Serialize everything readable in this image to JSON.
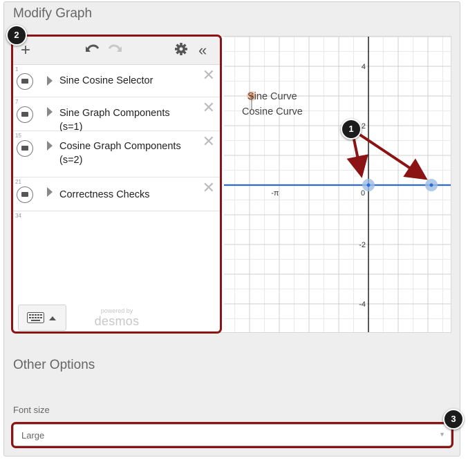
{
  "page": {
    "modify_graph_title": "Modify Graph",
    "other_options_title": "Other Options",
    "font_size_label": "Font size",
    "font_size_value": "Large"
  },
  "desmos": {
    "toolbar": {
      "add_icon": "plus-icon",
      "undo_icon": "undo-icon",
      "redo_icon": "redo-icon",
      "settings_icon": "gear-icon",
      "collapse_icon": "double-chevron-left-icon"
    },
    "expressions": [
      {
        "num": "1",
        "label": "Sine Cosine Selector"
      },
      {
        "num": "7",
        "label": "Sine Graph Components (s=1)"
      },
      {
        "num": "15",
        "label": "Cosine Graph Components (s=2)"
      },
      {
        "num": "21",
        "label": "Correctness Checks"
      }
    ],
    "empty_row_num": "34",
    "powered_by": "powered by",
    "brand": "desmos"
  },
  "graph": {
    "y_ticks": [
      {
        "label": "4",
        "value": 4
      },
      {
        "label": "2",
        "value": 2
      },
      {
        "label": "-2",
        "value": -2
      },
      {
        "label": "-4",
        "value": -4
      }
    ],
    "x_labels": [
      {
        "label": "-π",
        "value": -3.14159
      },
      {
        "label": "0",
        "value": 0
      }
    ],
    "curve_labels": [
      "Sine Curve",
      "Cosine Curve"
    ],
    "line_color": "#2d6bd3",
    "point_color": "#9dbde3",
    "orange_point_color": "#f0b088"
  },
  "callouts": {
    "badge_1": "1",
    "badge_2": "2",
    "badge_3": "3",
    "color": "#8b1313"
  }
}
